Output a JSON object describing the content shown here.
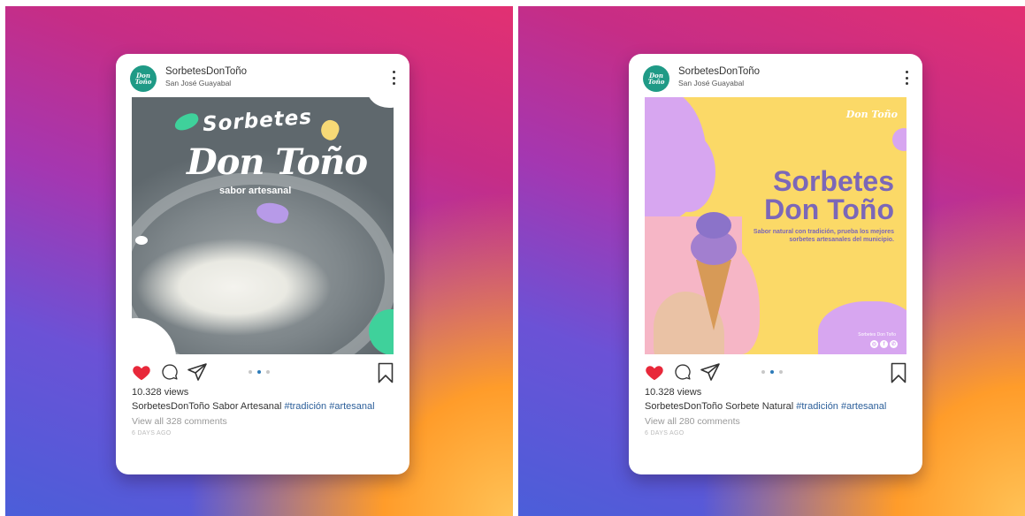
{
  "posts": [
    {
      "username": "SorbetesDonToño",
      "location": "San José Guayabal",
      "image_title_1": "Sorbetes",
      "image_title_2": "Don Toño",
      "image_tagline": "sabor artesanal",
      "views": "10.328 views",
      "caption_user": "SorbetesDonToño",
      "caption_text": "Sabor Artesanal",
      "tags": "#tradición #artesanal",
      "view_comments": "View all 328 comments",
      "time_ago": "6 DAYS AGO",
      "carousel_index": 2,
      "carousel_count": 3
    },
    {
      "username": "SorbetesDonToño",
      "location": "San José Guayabal",
      "image_logo": "Don Toño",
      "image_title_1": "Sorbetes",
      "image_title_2": "Don Toño",
      "image_description": "Sabor natural con tradición, prueba los mejores sorbetes artesanales del municipio.",
      "image_social_label": "Sorbetes Don Toño",
      "views": "10.328 views",
      "caption_user": "SorbetesDonToño",
      "caption_text": "Sorbete Natural",
      "tags": "#tradición #artesanal",
      "view_comments": "View all 280 comments",
      "time_ago": "6 DAYS AGO",
      "carousel_index": 2,
      "carousel_count": 3
    }
  ],
  "colors": {
    "like_red": "#e8283a",
    "tag_blue": "#2c5f9a",
    "brand_green": "#1f9a86",
    "lavender_text": "#7b67b8"
  },
  "icons": [
    "heart-icon",
    "comment-icon",
    "share-icon",
    "bookmark-icon",
    "more-icon"
  ]
}
